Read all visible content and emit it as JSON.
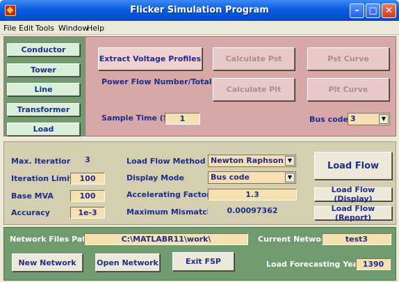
{
  "window": {
    "title": "Flicker Simulation Program"
  },
  "menu": [
    "File",
    "Edit",
    "Tools",
    "Window",
    "Help"
  ],
  "nav": [
    "Conductor",
    "Tower",
    "Line",
    "Transformer",
    "Load"
  ],
  "top": {
    "extract_button": "Extract Voltage Profiles",
    "power_flow_label": "Power Flow Number/Total",
    "calc_pst_button": "Calculate Pst",
    "calc_plt_button": "Calculate Plt",
    "pst_curve_button": "Pst Curve",
    "plt_curve_button": "Plt Curve",
    "sample_time_label": "Sample Time (S)",
    "sample_time_value": "1",
    "bus_code_label": "Bus code",
    "bus_code_value": "3"
  },
  "loadflow": {
    "max_iterations_label": "Max. Iterations",
    "max_iterations_value": "3",
    "iteration_limit_label": "Iteration Limit",
    "iteration_limit_value": "100",
    "base_mva_label": "Base MVA",
    "base_mva_value": "100",
    "accuracy_label": "Accuracy",
    "accuracy_value": "1e-3",
    "method_label": "Load Flow Method",
    "method_value": "Newton Raphson",
    "display_mode_label": "Display Mode",
    "display_mode_value": "Bus code",
    "accel_label": "Accelerating Factor",
    "accel_value": "1.3",
    "mismatch_label": "Maximum Mismatch",
    "mismatch_value": "0.00097362",
    "load_flow_button": "Load Flow",
    "load_flow_display_button": "Load Flow (Display)",
    "load_flow_report_button": "Load Flow (Report)"
  },
  "network": {
    "files_path_label": "Network Files Path",
    "files_path_value": "C:\\MATLABR11\\work\\",
    "current_network_label": "Current Network",
    "current_network_value": "test3",
    "new_network_button": "New Network",
    "open_network_button": "Open Network",
    "exit_button": "Exit  FSP",
    "forecast_label": "Load Forecasting Year",
    "forecast_value": "1390"
  },
  "colors": {
    "title_bar": "#0a5ddf",
    "top_panel": "#d8a8a8",
    "nav_panel": "#6f9b6f",
    "mid_panel": "#d3cfb0",
    "label_text": "#1e2c8c"
  }
}
